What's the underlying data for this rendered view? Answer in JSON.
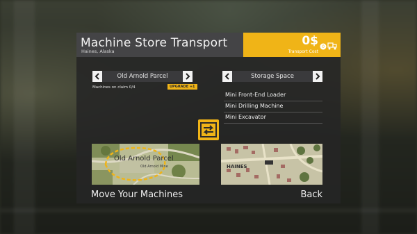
{
  "header": {
    "title": "Machine Store Transport",
    "subtitle": "Haines, Alaska"
  },
  "cost": {
    "value": "0$",
    "label": "Transport Cost",
    "icon": "tow-truck-icon"
  },
  "left_selector": {
    "label": "Old Arnold Parcel",
    "claim_text": "Machines on claim 0/4",
    "upgrade_label": "UPGRADE +1"
  },
  "right_selector": {
    "label": "Storage Space"
  },
  "machines": [
    "Mini Front-End Loader",
    "Mini Drilling Machine",
    "Mini Excavator"
  ],
  "maps": {
    "left_label": "Old Arnold Parcel",
    "left_sublabel": "Old Arnold Mine",
    "right_label": "HAINES"
  },
  "footer": {
    "move_label": "Move Your Machines",
    "back_label": "Back"
  },
  "colors": {
    "accent": "#f0b417",
    "panel": "#262626",
    "header": "#444446"
  }
}
